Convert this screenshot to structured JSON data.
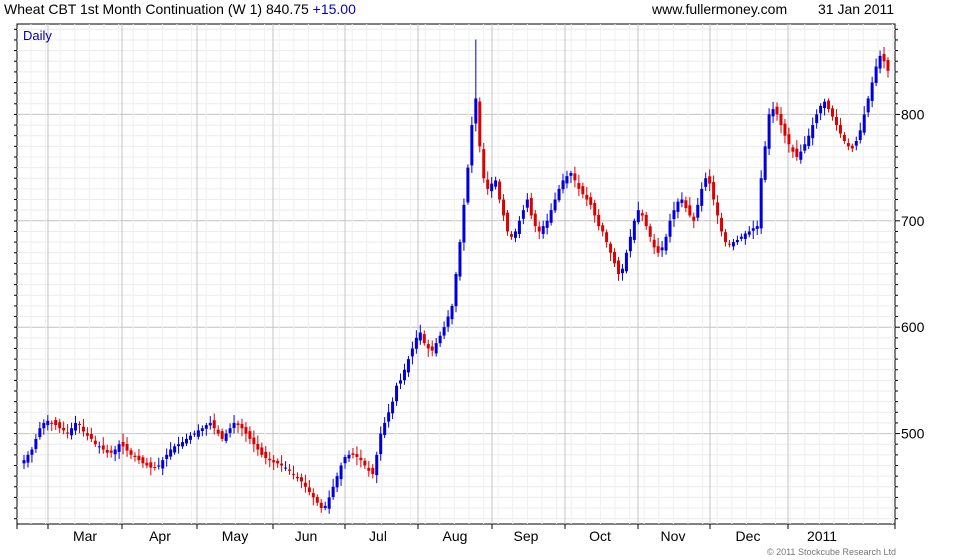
{
  "header": {
    "title": "Wheat CBT 1st Month Continuation (W 1) 840.75",
    "change": "+15.00",
    "website": "www.fullermoney.com",
    "date": "31 Jan 2011"
  },
  "period_label": "Daily",
  "copyright": "© 2011 Stockcube Research Ltd",
  "colors": {
    "up": "#0000dd",
    "down": "#dd0000",
    "grid": "#cccccc",
    "label": "#0000aa"
  },
  "chart_data": {
    "type": "candlestick",
    "x_tick_labels": [
      "Mar",
      "Apr",
      "May",
      "Jun",
      "Jul",
      "Aug",
      "Sep",
      "Oct",
      "Nov",
      "Dec",
      "2011"
    ],
    "y_tick_labels": [
      "500",
      "600",
      "700",
      "800"
    ],
    "ylim": [
      415,
      885
    ],
    "grid": true,
    "close_path": [
      475,
      480,
      485,
      495,
      505,
      510,
      512,
      510,
      508,
      505,
      503,
      500,
      505,
      510,
      508,
      502,
      498,
      495,
      490,
      488,
      485,
      482,
      482,
      485,
      490,
      488,
      484,
      480,
      478,
      475,
      472,
      470,
      468,
      468,
      470,
      475,
      480,
      485,
      488,
      490,
      492,
      495,
      498,
      500,
      503,
      505,
      508,
      510,
      505,
      500,
      495,
      500,
      505,
      510,
      508,
      505,
      500,
      495,
      490,
      485,
      480,
      477,
      475,
      473,
      472,
      470,
      468,
      465,
      462,
      458,
      455,
      450,
      445,
      440,
      435,
      430,
      432,
      440,
      450,
      460,
      470,
      478,
      480,
      480,
      478,
      475,
      470,
      465,
      462,
      480,
      500,
      510,
      520,
      530,
      545,
      550,
      560,
      570,
      580,
      590,
      595,
      585,
      580,
      578,
      585,
      592,
      600,
      610,
      620,
      650,
      680,
      715,
      750,
      790,
      815,
      770,
      740,
      730,
      735,
      738,
      720,
      705,
      690,
      685,
      690,
      700,
      710,
      720,
      705,
      695,
      690,
      695,
      700,
      710,
      720,
      730,
      738,
      742,
      745,
      738,
      730,
      725,
      720,
      715,
      705,
      695,
      690,
      680,
      670,
      660,
      650,
      655,
      670,
      685,
      700,
      710,
      705,
      695,
      685,
      675,
      670,
      675,
      685,
      700,
      710,
      718,
      720,
      712,
      705,
      700,
      715,
      730,
      740,
      735,
      720,
      705,
      690,
      680,
      678,
      680,
      682,
      685,
      688,
      690,
      693,
      695,
      740,
      770,
      800,
      805,
      800,
      790,
      780,
      772,
      765,
      760,
      765,
      772,
      780,
      790,
      800,
      808,
      812,
      805,
      798,
      790,
      782,
      775,
      770,
      768,
      775,
      785,
      800,
      815,
      830,
      845,
      855,
      850,
      841
    ],
    "last_close": 840.75
  }
}
